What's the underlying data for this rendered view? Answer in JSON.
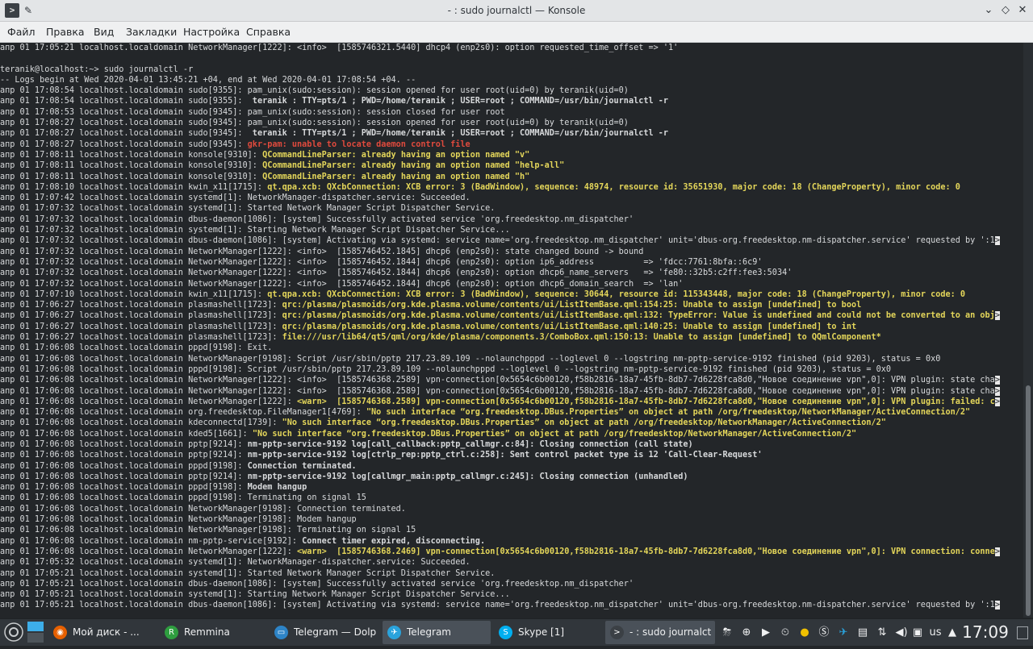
{
  "window": {
    "title": "- : sudo journalctl — Konsole"
  },
  "menubar": [
    "Файл",
    "Правка",
    "Вид",
    "Закладки",
    "Настройка",
    "Справка"
  ],
  "terminal": {
    "lines": [
      [
        [
          "p",
          "апр 01 17:05:21 localhost.localdomain NetworkManager[1222]: <info>  [1585746321.5440] dhcp4 (enp2s0): option requested_time_offset => '1'"
        ]
      ],
      [],
      [
        [
          "p",
          "teranik@localhost:~> sudo journalctl -r"
        ]
      ],
      [
        [
          "p",
          "-- Logs begin at Wed 2020-04-01 13:45:21 +04, end at Wed 2020-04-01 17:08:54 +04. --"
        ]
      ],
      [
        [
          "p",
          "апр 01 17:08:54 localhost.localdomain sudo[9355]: pam_unix(sudo:session): session opened for user root(uid=0) by teranik(uid=0)"
        ]
      ],
      [
        [
          "p",
          "апр 01 17:08:54 localhost.localdomain sudo[9355]: "
        ],
        [
          "m",
          " teranik : TTY=pts/1 ; PWD=/home/teranik ; USER=root ; COMMAND=/usr/bin/journalctl -r"
        ]
      ],
      [
        [
          "p",
          "апр 01 17:08:53 localhost.localdomain sudo[9345]: pam_unix(sudo:session): session closed for user root"
        ]
      ],
      [
        [
          "p",
          "апр 01 17:08:27 localhost.localdomain sudo[9345]: pam_unix(sudo:session): session opened for user root(uid=0) by teranik(uid=0)"
        ]
      ],
      [
        [
          "p",
          "апр 01 17:08:27 localhost.localdomain sudo[9345]: "
        ],
        [
          "m",
          " teranik : TTY=pts/1 ; PWD=/home/teranik ; USER=root ; COMMAND=/usr/bin/journalctl -r"
        ]
      ],
      [
        [
          "p",
          "апр 01 17:08:27 localhost.localdomain sudo[9345]: "
        ],
        [
          "e",
          "gkr-pam: unable to locate daemon control file"
        ]
      ],
      [
        [
          "p",
          "апр 01 17:08:11 localhost.localdomain konsole[9310]: "
        ],
        [
          "w",
          "QCommandLineParser: already having an option named \"v\""
        ]
      ],
      [
        [
          "p",
          "апр 01 17:08:11 localhost.localdomain konsole[9310]: "
        ],
        [
          "w",
          "QCommandLineParser: already having an option named \"help-all\""
        ]
      ],
      [
        [
          "p",
          "апр 01 17:08:11 localhost.localdomain konsole[9310]: "
        ],
        [
          "w",
          "QCommandLineParser: already having an option named \"h\""
        ]
      ],
      [
        [
          "p",
          "апр 01 17:08:10 localhost.localdomain kwin_x11[1715]: "
        ],
        [
          "w",
          "qt.qpa.xcb: QXcbConnection: XCB error: 3 (BadWindow), sequence: 48974, resource id: 35651930, major code: 18 (ChangeProperty), minor code: 0"
        ]
      ],
      [
        [
          "p",
          "апр 01 17:07:42 localhost.localdomain systemd[1]: NetworkManager-dispatcher.service: Succeeded."
        ]
      ],
      [
        [
          "p",
          "апр 01 17:07:32 localhost.localdomain systemd[1]: Started Network Manager Script Dispatcher Service."
        ]
      ],
      [
        [
          "p",
          "апр 01 17:07:32 localhost.localdomain dbus-daemon[1086]: [system] Successfully activated service 'org.freedesktop.nm_dispatcher'"
        ]
      ],
      [
        [
          "p",
          "апр 01 17:07:32 localhost.localdomain systemd[1]: Starting Network Manager Script Dispatcher Service..."
        ]
      ],
      [
        [
          "p",
          "апр 01 17:07:32 localhost.localdomain dbus-daemon[1086]: [system] Activating via systemd: service name='org.freedesktop.nm_dispatcher' unit='dbus-org.freedesktop.nm-dispatcher.service' requested by ':1"
        ],
        [
          "cur",
          ">"
        ]
      ],
      [
        [
          "p",
          "апр 01 17:07:32 localhost.localdomain NetworkManager[1222]: <info>  [1585746452.1845] dhcp6 (enp2s0): state changed bound -> bound"
        ]
      ],
      [
        [
          "p",
          "апр 01 17:07:32 localhost.localdomain NetworkManager[1222]: <info>  [1585746452.1844] dhcp6 (enp2s0): option ip6_address          => 'fdcc:7761:8bfa::6c9'"
        ]
      ],
      [
        [
          "p",
          "апр 01 17:07:32 localhost.localdomain NetworkManager[1222]: <info>  [1585746452.1844] dhcp6 (enp2s0): option dhcp6_name_servers   => 'fe80::32b5:c2ff:fee3:5034'"
        ]
      ],
      [
        [
          "p",
          "апр 01 17:07:32 localhost.localdomain NetworkManager[1222]: <info>  [1585746452.1844] dhcp6 (enp2s0): option dhcp6_domain_search  => 'lan'"
        ]
      ],
      [
        [
          "p",
          "апр 01 17:07:10 localhost.localdomain kwin_x11[1715]: "
        ],
        [
          "w",
          "qt.qpa.xcb: QXcbConnection: XCB error: 3 (BadWindow), sequence: 30644, resource id: 115343448, major code: 18 (ChangeProperty), minor code: 0"
        ]
      ],
      [
        [
          "p",
          "апр 01 17:06:27 localhost.localdomain plasmashell[1723]: "
        ],
        [
          "w",
          "qrc:/plasma/plasmoids/org.kde.plasma.volume/contents/ui/ListItemBase.qml:154:25: Unable to assign [undefined] to bool"
        ]
      ],
      [
        [
          "p",
          "апр 01 17:06:27 localhost.localdomain plasmashell[1723]: "
        ],
        [
          "w",
          "qrc:/plasma/plasmoids/org.kde.plasma.volume/contents/ui/ListItemBase.qml:132: TypeError: Value is undefined and could not be converted to an obj"
        ],
        [
          "cur",
          ">"
        ]
      ],
      [
        [
          "p",
          "апр 01 17:06:27 localhost.localdomain plasmashell[1723]: "
        ],
        [
          "w",
          "qrc:/plasma/plasmoids/org.kde.plasma.volume/contents/ui/ListItemBase.qml:140:25: Unable to assign [undefined] to int"
        ]
      ],
      [
        [
          "p",
          "апр 01 17:06:27 localhost.localdomain plasmashell[1723]: "
        ],
        [
          "w",
          "file:///usr/lib64/qt5/qml/org/kde/plasma/components.3/ComboBox.qml:150:13: Unable to assign [undefined] to QQmlComponent*"
        ]
      ],
      [
        [
          "p",
          "апр 01 17:06:08 localhost.localdomain pppd[9198]: Exit."
        ]
      ],
      [
        [
          "p",
          "апр 01 17:06:08 localhost.localdomain NetworkManager[9198]: Script /usr/sbin/pptp 217.23.89.109 --nolaunchpppd --loglevel 0 --logstring nm-pptp-service-9192 finished (pid 9203), status = 0x0"
        ]
      ],
      [
        [
          "p",
          "апр 01 17:06:08 localhost.localdomain pppd[9198]: Script /usr/sbin/pptp 217.23.89.109 --nolaunchpppd --loglevel 0 --logstring nm-pptp-service-9192 finished (pid 9203), status = 0x0"
        ]
      ],
      [
        [
          "p",
          "апр 01 17:06:08 localhost.localdomain NetworkManager[1222]: <info>  [1585746368.2589] vpn-connection[0x5654c6b00120,f58b2816-18a7-45fb-8db7-7d6228fca8d0,\"Новое соединение vpn\",0]: VPN plugin: state cha"
        ],
        [
          "cur",
          ">"
        ]
      ],
      [
        [
          "p",
          "апр 01 17:06:08 localhost.localdomain NetworkManager[1222]: <info>  [1585746368.2589] vpn-connection[0x5654c6b00120,f58b2816-18a7-45fb-8db7-7d6228fca8d0,\"Новое соединение vpn\",0]: VPN plugin: state cha"
        ],
        [
          "cur",
          ">"
        ]
      ],
      [
        [
          "p",
          "апр 01 17:06:08 localhost.localdomain NetworkManager[1222]: "
        ],
        [
          "w",
          "<warn>  [1585746368.2589] vpn-connection[0x5654c6b00120,f58b2816-18a7-45fb-8db7-7d6228fca8d0,\"Новое соединение vpn\",0]: VPN plugin: failed: c"
        ],
        [
          "cur",
          ">"
        ]
      ],
      [
        [
          "p",
          "апр 01 17:06:08 localhost.localdomain org.freedesktop.FileManager1[4769]: "
        ],
        [
          "w",
          "\"No such interface “org.freedesktop.DBus.Properties” on object at path /org/freedesktop/NetworkManager/ActiveConnection/2\""
        ]
      ],
      [
        [
          "p",
          "апр 01 17:06:08 localhost.localdomain kdeconnectd[1739]: "
        ],
        [
          "w",
          "\"No such interface “org.freedesktop.DBus.Properties” on object at path /org/freedesktop/NetworkManager/ActiveConnection/2\""
        ]
      ],
      [
        [
          "p",
          "апр 01 17:06:08 localhost.localdomain kded5[1661]: "
        ],
        [
          "w",
          "\"No such interface “org.freedesktop.DBus.Properties” on object at path /org/freedesktop/NetworkManager/ActiveConnection/2\""
        ]
      ],
      [
        [
          "p",
          "апр 01 17:06:08 localhost.localdomain pptp[9214]: "
        ],
        [
          "m",
          "nm-pptp-service-9192 log[call_callback:pptp_callmgr.c:84]: Closing connection (call state)"
        ]
      ],
      [
        [
          "p",
          "апр 01 17:06:08 localhost.localdomain pptp[9214]: "
        ],
        [
          "m",
          "nm-pptp-service-9192 log[ctrlp_rep:pptp_ctrl.c:258]: Sent control packet type is 12 'Call-Clear-Request'"
        ]
      ],
      [
        [
          "p",
          "апр 01 17:06:08 localhost.localdomain pppd[9198]: "
        ],
        [
          "m",
          "Connection terminated."
        ]
      ],
      [
        [
          "p",
          "апр 01 17:06:08 localhost.localdomain pptp[9214]: "
        ],
        [
          "m",
          "nm-pptp-service-9192 log[callmgr_main:pptp_callmgr.c:245]: Closing connection (unhandled)"
        ]
      ],
      [
        [
          "p",
          "апр 01 17:06:08 localhost.localdomain pppd[9198]: "
        ],
        [
          "m",
          "Modem hangup"
        ]
      ],
      [
        [
          "p",
          "апр 01 17:06:08 localhost.localdomain pppd[9198]: Terminating on signal 15"
        ]
      ],
      [
        [
          "p",
          "апр 01 17:06:08 localhost.localdomain NetworkManager[9198]: Connection terminated."
        ]
      ],
      [
        [
          "p",
          "апр 01 17:06:08 localhost.localdomain NetworkManager[9198]: Modem hangup"
        ]
      ],
      [
        [
          "p",
          "апр 01 17:06:08 localhost.localdomain NetworkManager[9198]: Terminating on signal 15"
        ]
      ],
      [
        [
          "p",
          "апр 01 17:06:08 localhost.localdomain nm-pptp-service[9192]: "
        ],
        [
          "m",
          "Connect timer expired, disconnecting."
        ]
      ],
      [
        [
          "p",
          "апр 01 17:06:08 localhost.localdomain NetworkManager[1222]: "
        ],
        [
          "w",
          "<warn>  [1585746368.2469] vpn-connection[0x5654c6b00120,f58b2816-18a7-45fb-8db7-7d6228fca8d0,\"Новое соединение vpn\",0]: VPN connection: conne"
        ],
        [
          "cur",
          ">"
        ]
      ],
      [
        [
          "p",
          "апр 01 17:05:32 localhost.localdomain systemd[1]: NetworkManager-dispatcher.service: Succeeded."
        ]
      ],
      [
        [
          "p",
          "апр 01 17:05:21 localhost.localdomain systemd[1]: Started Network Manager Script Dispatcher Service."
        ]
      ],
      [
        [
          "p",
          "апр 01 17:05:21 localhost.localdomain dbus-daemon[1086]: [system] Successfully activated service 'org.freedesktop.nm_dispatcher'"
        ]
      ],
      [
        [
          "p",
          "апр 01 17:05:21 localhost.localdomain systemd[1]: Starting Network Manager Script Dispatcher Service..."
        ]
      ],
      [
        [
          "p",
          "апр 01 17:05:21 localhost.localdomain dbus-daemon[1086]: [system] Activating via systemd: service name='org.freedesktop.nm_dispatcher' unit='dbus-org.freedesktop.nm-dispatcher.service' requested by ':1"
        ],
        [
          "cur",
          ">"
        ]
      ]
    ]
  },
  "taskbar": {
    "tasks": [
      {
        "label": "Мой диск - ...",
        "icon": "firefox-icon",
        "color": "#e66000",
        "active": false
      },
      {
        "label": "Remmina",
        "icon": "remmina-icon",
        "color": "#2e9e3f",
        "active": false
      },
      {
        "label": "Telegram — Dolp...",
        "icon": "dolphin-icon",
        "color": "#2d84c7",
        "active": false
      },
      {
        "label": "Telegram",
        "icon": "telegram-icon",
        "color": "#2aa3dc",
        "active": true
      },
      {
        "label": "Skype [1]",
        "icon": "skype-icon",
        "color": "#00aff0",
        "active": false
      },
      {
        "label": "- : sudo journalctl...",
        "icon": "konsole-icon",
        "color": "#3b4045",
        "active": true
      }
    ],
    "keyboard_layout": "us",
    "clock": "17:09"
  }
}
